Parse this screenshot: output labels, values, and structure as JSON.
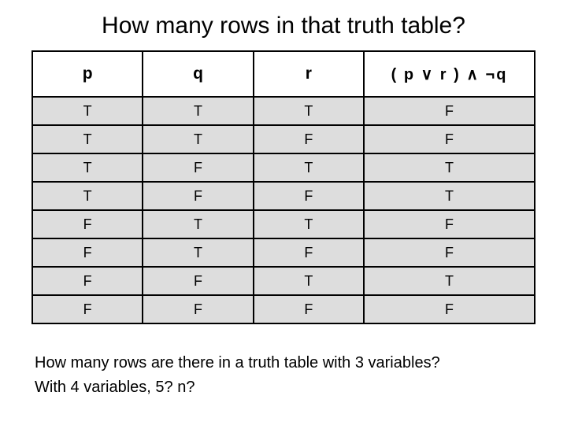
{
  "title": "How many rows in that truth table?",
  "columns": [
    "p",
    "q",
    "r",
    "( p ∨ r ) ∧ ¬q"
  ],
  "rows": [
    [
      "T",
      "T",
      "T",
      "F"
    ],
    [
      "T",
      "T",
      "F",
      "F"
    ],
    [
      "T",
      "F",
      "T",
      "T"
    ],
    [
      "T",
      "F",
      "F",
      "T"
    ],
    [
      "F",
      "T",
      "T",
      "F"
    ],
    [
      "F",
      "T",
      "F",
      "F"
    ],
    [
      "F",
      "F",
      "T",
      "T"
    ],
    [
      "F",
      "F",
      "F",
      "F"
    ]
  ],
  "footer_line1": "How many rows are there in a truth table with 3 variables?",
  "footer_line2": "With 4 variables, 5? n?",
  "chart_data": {
    "type": "table",
    "title": "How many rows in that truth table?",
    "columns": [
      "p",
      "q",
      "r",
      "( p ∨ r ) ∧ ¬q"
    ],
    "rows": [
      [
        "T",
        "T",
        "T",
        "F"
      ],
      [
        "T",
        "T",
        "F",
        "F"
      ],
      [
        "T",
        "F",
        "T",
        "T"
      ],
      [
        "T",
        "F",
        "F",
        "T"
      ],
      [
        "F",
        "T",
        "T",
        "F"
      ],
      [
        "F",
        "T",
        "F",
        "F"
      ],
      [
        "F",
        "F",
        "T",
        "T"
      ],
      [
        "F",
        "F",
        "F",
        "F"
      ]
    ]
  }
}
